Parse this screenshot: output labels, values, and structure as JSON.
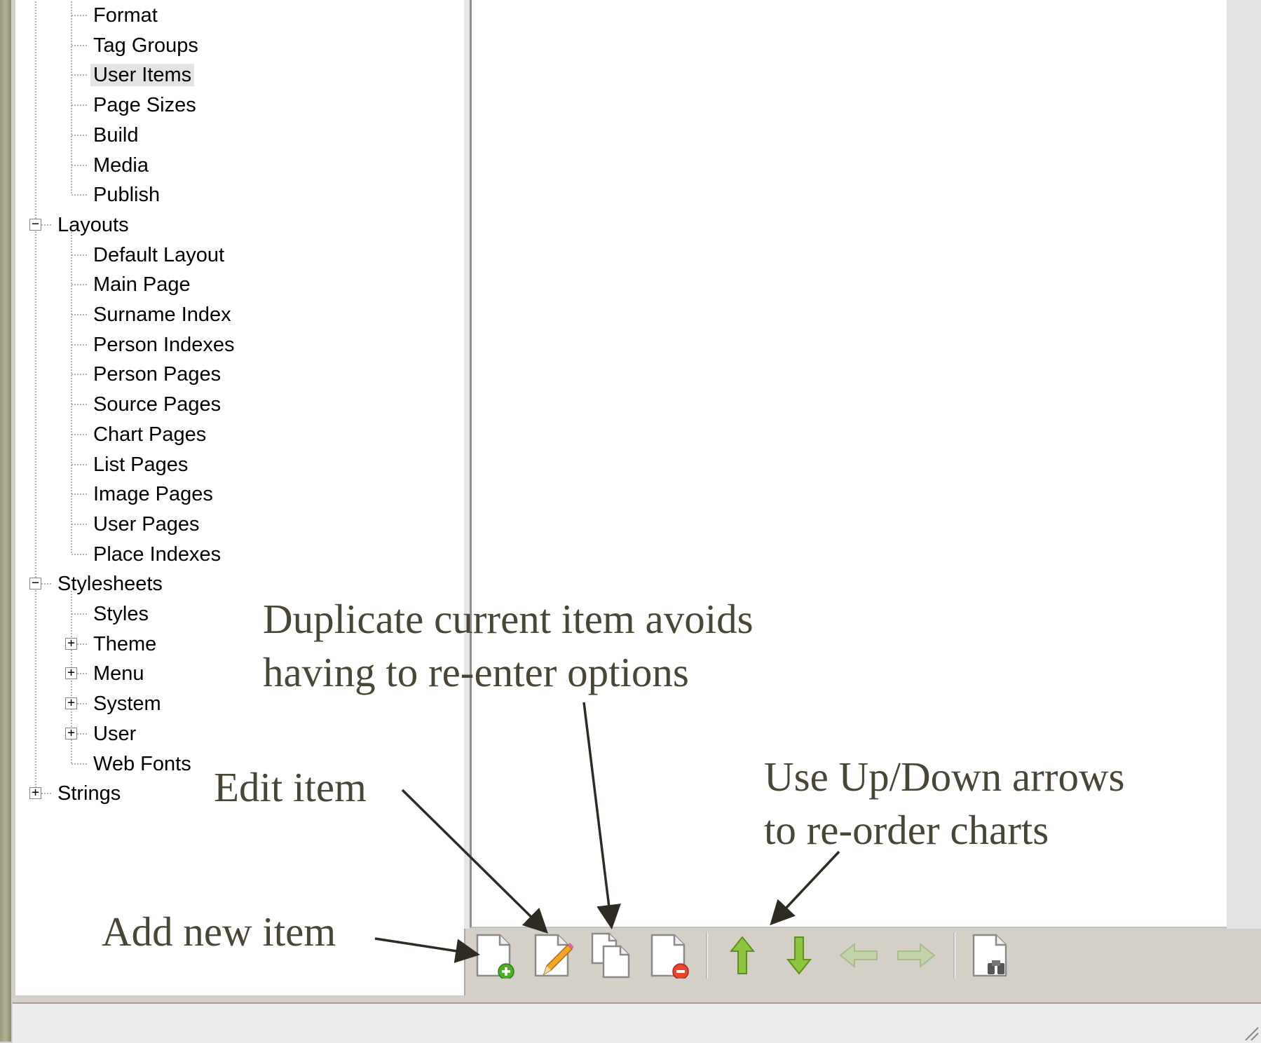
{
  "tree": {
    "items": [
      {
        "label": "Format"
      },
      {
        "label": "Tag Groups"
      },
      {
        "label": "User Items"
      },
      {
        "label": "Page Sizes"
      },
      {
        "label": "Build"
      },
      {
        "label": "Media"
      },
      {
        "label": "Publish"
      },
      {
        "label": "Layouts"
      },
      {
        "label": "Default Layout"
      },
      {
        "label": "Main Page"
      },
      {
        "label": "Surname Index"
      },
      {
        "label": "Person Indexes"
      },
      {
        "label": "Person Pages"
      },
      {
        "label": "Source Pages"
      },
      {
        "label": "Chart Pages"
      },
      {
        "label": "List Pages"
      },
      {
        "label": "Image Pages"
      },
      {
        "label": "User Pages"
      },
      {
        "label": "Place Indexes"
      },
      {
        "label": "Stylesheets"
      },
      {
        "label": "Styles"
      },
      {
        "label": "Theme"
      },
      {
        "label": "Menu"
      },
      {
        "label": "System"
      },
      {
        "label": "User"
      },
      {
        "label": "Web Fonts"
      },
      {
        "label": "Strings"
      }
    ],
    "selected": "User Items"
  },
  "toolbar": {
    "buttons": [
      {
        "name": "add-item",
        "icon": "page-add-icon"
      },
      {
        "name": "edit-item",
        "icon": "page-edit-icon"
      },
      {
        "name": "duplicate-item",
        "icon": "page-copy-icon"
      },
      {
        "name": "delete-item",
        "icon": "page-delete-icon"
      },
      {
        "name": "move-up",
        "icon": "arrow-up-icon"
      },
      {
        "name": "move-down",
        "icon": "arrow-down-icon"
      },
      {
        "name": "move-left",
        "icon": "arrow-left-icon"
      },
      {
        "name": "move-right",
        "icon": "arrow-right-icon"
      },
      {
        "name": "find",
        "icon": "page-binoculars-icon"
      }
    ]
  },
  "annotations": {
    "duplicate_line1": "Duplicate current item avoids",
    "duplicate_line2": "having to re-enter options",
    "edit": "Edit item",
    "updown_line1": "Use Up/Down arrows",
    "updown_line2": "to re-order charts",
    "add": "Add new item"
  },
  "colors": {
    "annotation_text": "#4a4636",
    "arrow_up_down": "#8cc63f",
    "arrow_left_right_disabled": "#c3d3a8",
    "delete_badge": "#e8452c",
    "add_badge": "#4caf2a"
  }
}
